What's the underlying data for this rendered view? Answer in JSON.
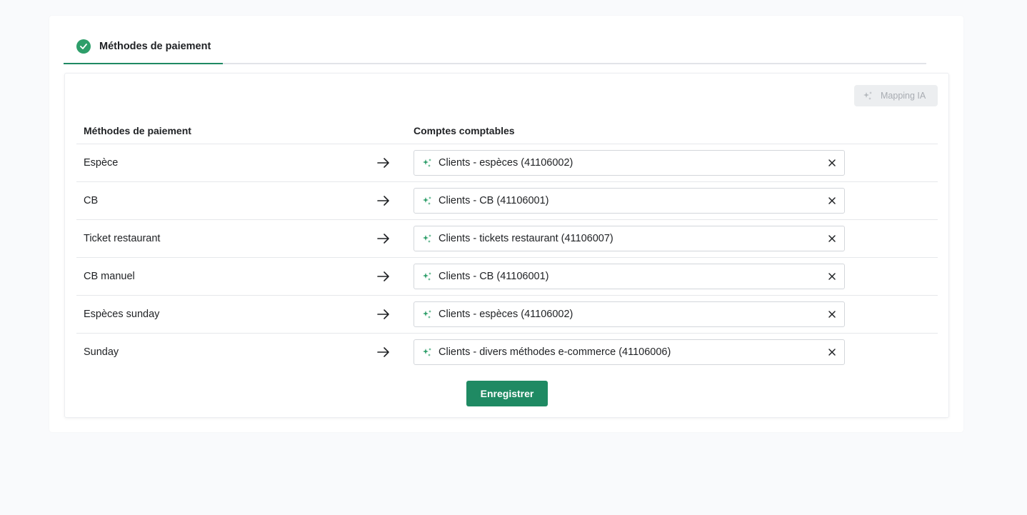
{
  "tabs": [
    {
      "label": "Méthodes de paiement",
      "status": "completed",
      "active": true
    }
  ],
  "toolbar": {
    "mapping_label": "Mapping IA",
    "mapping_icon": "sparkle-icon",
    "mapping_disabled": true
  },
  "table": {
    "headers": {
      "methods": "Méthodes de paiement",
      "accounts": "Comptes comptables"
    },
    "rows": [
      {
        "method": "Espèce",
        "account": "Clients - espèces (41106002)"
      },
      {
        "method": "CB",
        "account": "Clients - CB (41106001)"
      },
      {
        "method": "Ticket restaurant",
        "account": "Clients - tickets restaurant (41106007)"
      },
      {
        "method": "CB manuel",
        "account": "Clients - CB (41106001)"
      },
      {
        "method": "Espèces sunday",
        "account": "Clients - espèces (41106002)"
      },
      {
        "method": "Sunday",
        "account": "Clients - divers méthodes e-commerce (41106006)"
      }
    ]
  },
  "actions": {
    "save_label": "Enregistrer"
  },
  "colors": {
    "accent": "#1f8a63",
    "success": "#2e9e6a",
    "ai_sparkle": "#2e9e6a",
    "background": "#f9fafc"
  }
}
